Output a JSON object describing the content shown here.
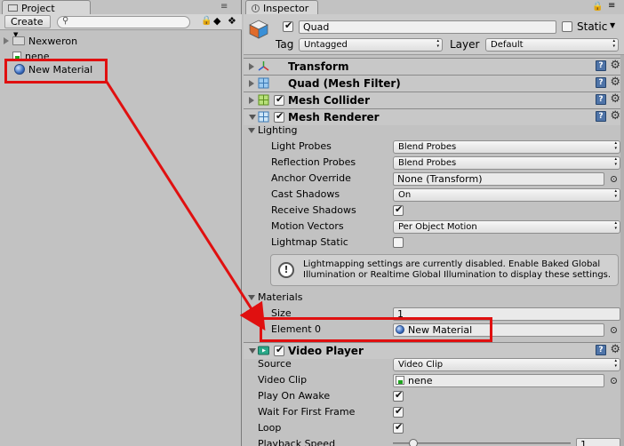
{
  "project": {
    "tab_label": "Project",
    "create_label": "Create",
    "search_placeholder": "",
    "items": [
      {
        "label": "Nexweron",
        "type": "folder"
      },
      {
        "label": "nene",
        "type": "texture"
      },
      {
        "label": "New Material",
        "type": "material"
      }
    ]
  },
  "inspector": {
    "tab_label": "Inspector",
    "object_name": "Quad",
    "static_label": "Static",
    "tag_label": "Tag",
    "tag_value": "Untagged",
    "layer_label": "Layer",
    "layer_value": "Default",
    "components": {
      "transform": "Transform",
      "mesh_filter": "Quad (Mesh Filter)",
      "mesh_collider": "Mesh Collider",
      "mesh_renderer": "Mesh Renderer",
      "video_player": "Video Player"
    },
    "lighting": {
      "section": "Lighting",
      "light_probes_label": "Light Probes",
      "light_probes_value": "Blend Probes",
      "reflection_probes_label": "Reflection Probes",
      "reflection_probes_value": "Blend Probes",
      "anchor_override_label": "Anchor Override",
      "anchor_override_value": "None (Transform)",
      "cast_shadows_label": "Cast Shadows",
      "cast_shadows_value": "On",
      "receive_shadows_label": "Receive Shadows",
      "motion_vectors_label": "Motion Vectors",
      "motion_vectors_value": "Per Object Motion",
      "lightmap_static_label": "Lightmap Static",
      "info": "Lightmapping settings are currently disabled. Enable Baked Global Illumination or Realtime Global Illumination to display these settings."
    },
    "materials": {
      "section": "Materials",
      "size_label": "Size",
      "size_value": "1",
      "element0_label": "Element 0",
      "element0_value": "New Material"
    },
    "video": {
      "source_label": "Source",
      "source_value": "Video Clip",
      "clip_label": "Video Clip",
      "clip_value": "nene",
      "play_on_awake_label": "Play On Awake",
      "wait_first_frame_label": "Wait For First Frame",
      "loop_label": "Loop",
      "playback_speed_label": "Playback Speed",
      "playback_speed_value": "1"
    }
  },
  "colors": {
    "annotation": "#e01010",
    "panel_bg": "#c2c2c2"
  }
}
